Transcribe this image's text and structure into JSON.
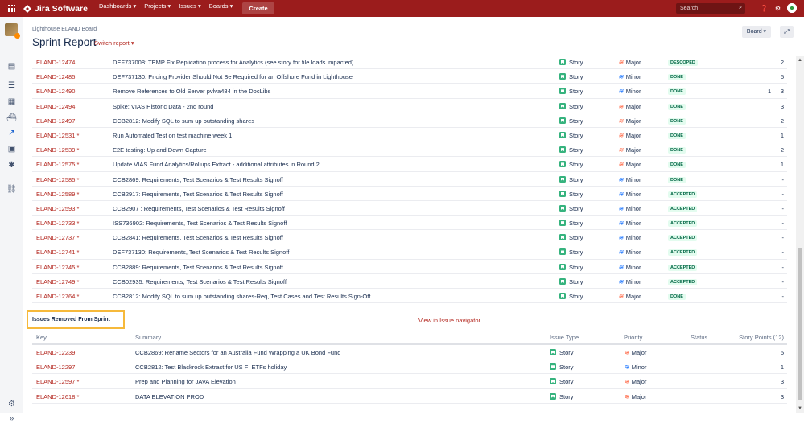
{
  "topnav": {
    "product": "Jira Software",
    "menus": [
      "Dashboards ▾",
      "Projects ▾",
      "Issues ▾",
      "Boards ▾"
    ],
    "create": "Create",
    "search_placeholder": "Search"
  },
  "header": {
    "board_name": "Lighthouse ELAND Board",
    "title": "Sprint Report",
    "switch_report": "Switch report ▾",
    "board_button": "Board ▾"
  },
  "issues": [
    {
      "key": "ELAND-12474",
      "summary": "DEF737008: TEMP Fix Replication process for Analytics (see story for file loads impacted)",
      "type": "Story",
      "priority": "Major",
      "status": "DESCOPED",
      "points": "2"
    },
    {
      "key": "ELAND-12485",
      "summary": "DEF737130: Pricing Provider Should Not Be Required for an Offshore Fund in Lighthouse",
      "type": "Story",
      "priority": "Minor",
      "status": "DONE",
      "points": "5"
    },
    {
      "key": "ELAND-12490",
      "summary": "Remove References to Old Server pvlva484 in the DocLibs",
      "type": "Story",
      "priority": "Minor",
      "status": "DONE",
      "points": "1 → 3"
    },
    {
      "key": "ELAND-12494",
      "summary": "Spike: VIAS Historic Data - 2nd round",
      "type": "Story",
      "priority": "Major",
      "status": "DONE",
      "points": "3"
    },
    {
      "key": "ELAND-12497",
      "summary": "CCB2812: Modify SQL to sum up outstanding shares",
      "type": "Story",
      "priority": "Major",
      "status": "DONE",
      "points": "2"
    },
    {
      "key": "ELAND-12531 *",
      "summary": "Run Automated Test on test machine week 1",
      "type": "Story",
      "priority": "Major",
      "status": "DONE",
      "points": "1"
    },
    {
      "key": "ELAND-12539 *",
      "summary": "E2E testing: Up and Down Capture",
      "type": "Story",
      "priority": "Major",
      "status": "DONE",
      "points": "2"
    },
    {
      "key": "ELAND-12575 *",
      "summary": "Update VIAS Fund Analytics/Rollups Extract - additional attributes in Round 2",
      "type": "Story",
      "priority": "Major",
      "status": "DONE",
      "points": "1"
    },
    {
      "key": "ELAND-12585 *",
      "summary": "CCB2869: Requirements, Test Scenarios & Test Results Signoff",
      "type": "Story",
      "priority": "Minor",
      "status": "DONE",
      "points": "-"
    },
    {
      "key": "ELAND-12589 *",
      "summary": "CCB2917: Requirements, Test Scenarios & Test Results Signoff",
      "type": "Story",
      "priority": "Minor",
      "status": "ACCEPTED",
      "points": "-"
    },
    {
      "key": "ELAND-12593 *",
      "summary": "CCB2907 : Requirements, Test Scenarios & Test Results Signoff",
      "type": "Story",
      "priority": "Minor",
      "status": "ACCEPTED",
      "points": "-"
    },
    {
      "key": "ELAND-12733 *",
      "summary": "ISS736902: Requirements, Test Scenarios & Test Results Signoff",
      "type": "Story",
      "priority": "Minor",
      "status": "ACCEPTED",
      "points": "-"
    },
    {
      "key": "ELAND-12737 *",
      "summary": "CCB2841: Requirements, Test Scenarios & Test Results Signoff",
      "type": "Story",
      "priority": "Minor",
      "status": "ACCEPTED",
      "points": "-"
    },
    {
      "key": "ELAND-12741 *",
      "summary": "DEF737130: Requirements, Test Scenarios & Test Results Signoff",
      "type": "Story",
      "priority": "Minor",
      "status": "ACCEPTED",
      "points": "-"
    },
    {
      "key": "ELAND-12745 *",
      "summary": "CCB2889: Requirements, Test Scenarios & Test Results Signoff",
      "type": "Story",
      "priority": "Minor",
      "status": "ACCEPTED",
      "points": "-"
    },
    {
      "key": "ELAND-12749 *",
      "summary": "CCB02935: Requirements, Test Scenarios & Test Results Signoff",
      "type": "Story",
      "priority": "Minor",
      "status": "ACCEPTED",
      "points": "-"
    },
    {
      "key": "ELAND-12764 *",
      "summary": "CCB2812: Modify SQL to sum up outstanding shares-Req, Test Cases and Test Results Sign-Off",
      "type": "Story",
      "priority": "Major",
      "status": "DONE",
      "points": "-"
    }
  ],
  "removed": {
    "title": "Issues Removed From Sprint",
    "view_link": "View in Issue navigator",
    "columns": {
      "key": "Key",
      "summary": "Summary",
      "type": "Issue Type",
      "priority": "Priority",
      "status": "Status",
      "points": "Story Points (12)"
    },
    "rows": [
      {
        "key": "ELAND-12239",
        "summary": "CCB2869: Rename Sectors for an Australia Fund Wrapping a UK Bond Fund",
        "type": "Story",
        "priority": "Major",
        "points": "5"
      },
      {
        "key": "ELAND-12297",
        "summary": "CCB2812: Test Blackrock Extract for US FI ETFs holiday",
        "type": "Story",
        "priority": "Minor",
        "points": "1"
      },
      {
        "key": "ELAND-12597 *",
        "summary": "Prep and Planning for JAVA Elevation",
        "type": "Story",
        "priority": "Major",
        "points": "3"
      },
      {
        "key": "ELAND-12618 *",
        "summary": "DATA ELEVATION PROD",
        "type": "Story",
        "priority": "Major",
        "points": "3"
      }
    ]
  },
  "sidebar_icons": [
    "project-avatar",
    "backlog-icon",
    "board-icon",
    "roadmap-icon",
    "releases-icon",
    "reports-icon",
    "issues-icon",
    "components-icon",
    "link-icon",
    "settings-icon",
    "expand-icon"
  ],
  "colors": {
    "topnav": "#9b1c1c",
    "link": "#b3261e",
    "highlight": "#f6b93b"
  }
}
